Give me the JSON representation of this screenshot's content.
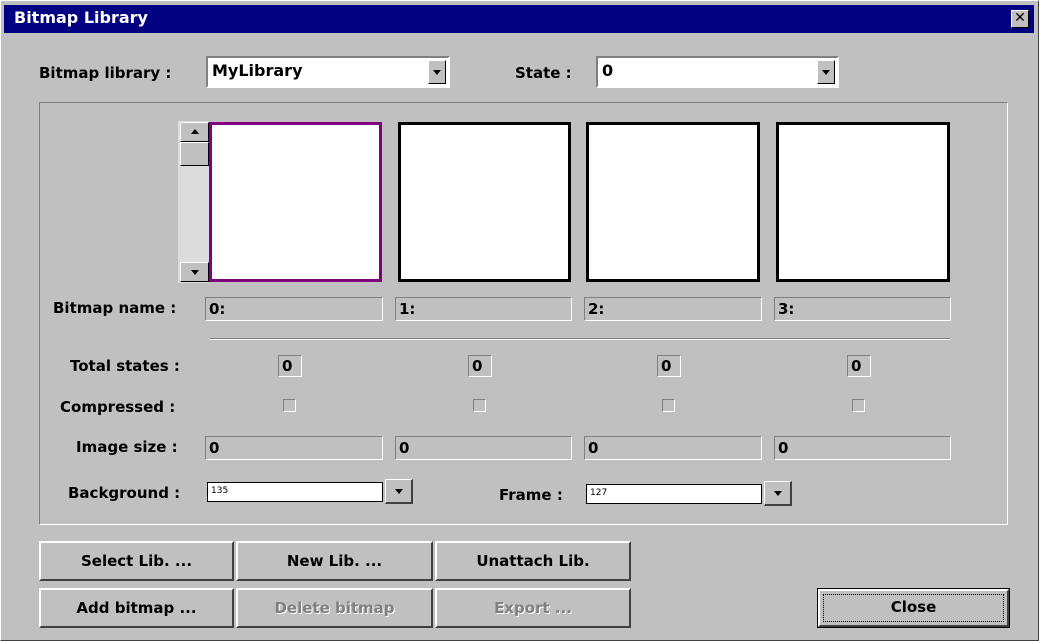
{
  "window": {
    "title": "Bitmap Library",
    "close_glyph": "✕"
  },
  "library": {
    "label": "Bitmap library :",
    "value": "MyLibrary"
  },
  "state": {
    "label": "State :",
    "value": "0"
  },
  "bitmap_name_label": "Bitmap name :",
  "slots": [
    {
      "name": "0:",
      "total_states": "0",
      "image_size": "0",
      "selected": true
    },
    {
      "name": "1:",
      "total_states": "0",
      "image_size": "0",
      "selected": false
    },
    {
      "name": "2:",
      "total_states": "0",
      "image_size": "0",
      "selected": false
    },
    {
      "name": "3:",
      "total_states": "0",
      "image_size": "0",
      "selected": false
    }
  ],
  "total_states_label": "Total states :",
  "compressed_label": "Compressed :",
  "image_size_label": "Image size :",
  "background": {
    "label": "Background :",
    "value": "135"
  },
  "frame": {
    "label": "Frame :",
    "value": "127"
  },
  "buttons": {
    "select_lib": "Select Lib. ...",
    "new_lib": "New Lib. ...",
    "unattach_lib": "Unattach Lib.",
    "add_bitmap": "Add bitmap ...",
    "delete_bitmap": "Delete bitmap",
    "export": "Export ...",
    "close": "Close"
  },
  "colors": {
    "titlebar": "#000080",
    "selected_frame": "#800080",
    "face": "#c0c0c0"
  }
}
